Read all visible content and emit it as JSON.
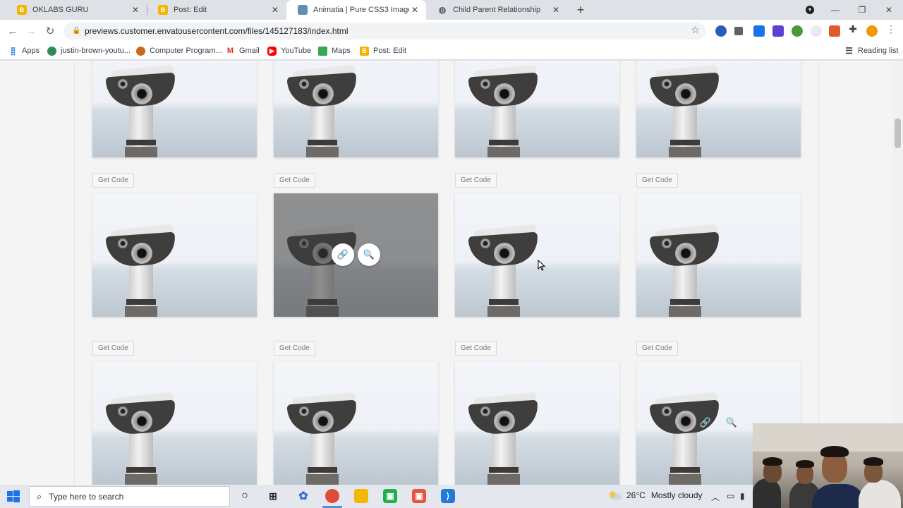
{
  "browser": {
    "tabs": [
      {
        "title": "OKLABS GURU",
        "icon_color": "#f4b400",
        "active": false
      },
      {
        "title": "Post: Edit",
        "icon_color": "#f4b400",
        "active": false
      },
      {
        "title": "Animatia | Pure CSS3 Image Hove",
        "icon_color": "#5f8fb5",
        "active": true
      },
      {
        "title": "Child Parent Relationship",
        "icon_color": "#5f6368",
        "active": false
      }
    ],
    "new_tab_label": "+",
    "url": "previews.customer.envatousercontent.com/files/145127183/index.html",
    "bookmarks": [
      {
        "label": "Apps",
        "icon": "apps-grid-icon"
      },
      {
        "label": "justin-brown-youtu...",
        "icon": "justin-icon"
      },
      {
        "label": "Computer Program...",
        "icon": "computer-program-icon"
      },
      {
        "label": "Gmail",
        "icon": "gmail-icon"
      },
      {
        "label": "YouTube",
        "icon": "youtube-icon"
      },
      {
        "label": "Maps",
        "icon": "maps-icon"
      },
      {
        "label": "Post: Edit",
        "icon": "blogger-icon"
      }
    ],
    "reading_list_label": "Reading list"
  },
  "gallery": {
    "get_code_label": "Get Code",
    "link_glyph": "🔗",
    "zoom_glyph": "🔍",
    "hovered_item": "row2-col2"
  },
  "taskbar": {
    "search_placeholder": "Type here to search",
    "weather_temp": "26°C",
    "weather_text": "Mostly cloudy"
  }
}
